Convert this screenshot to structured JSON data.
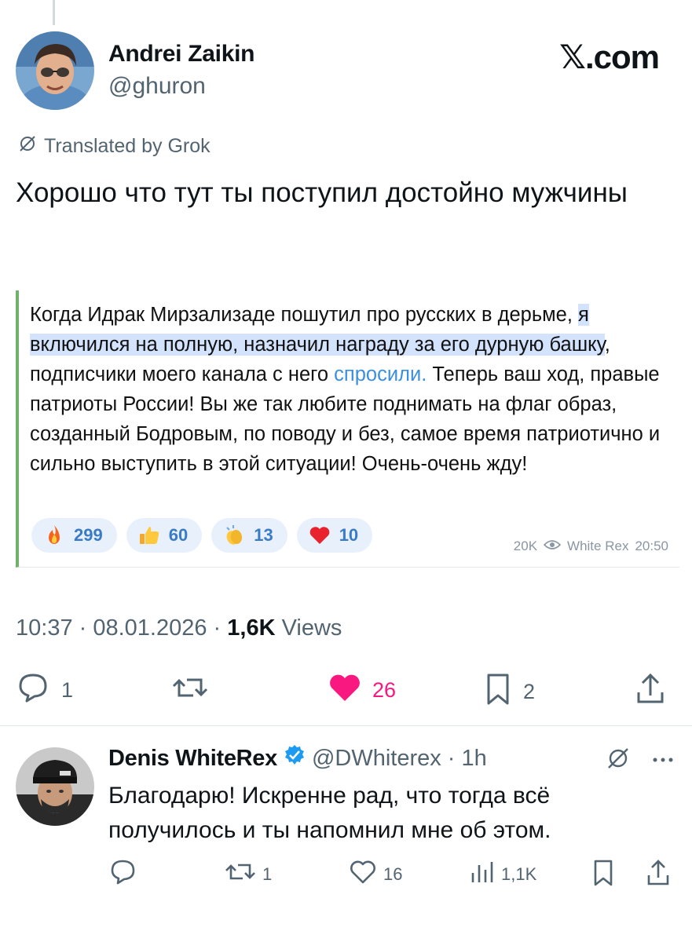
{
  "tweet": {
    "author_name": "Andrei Zaikin",
    "author_handle": "@ghuron",
    "brand": "𝕏.com",
    "translated_label": "Translated by Grok",
    "text": "Хорошо что тут ты поступил достойно мужчины",
    "timestamp": "10:37 · 08.01.2026 · ",
    "views_count": "1,6K",
    "views_label": " Views",
    "replies": "1",
    "likes": "26",
    "bookmarks": "2",
    "like_color": "#f91880"
  },
  "telegram_post": {
    "text_before": "Когда Идрак Мирзализаде пошутил про русских в дерьме, ",
    "text_highlighted": "я включился на полную, назначил награду за его дурную башку",
    "text_middle": ", подписчики моего канала с него ",
    "link_text": "спросили.",
    "text_after": " Теперь ваш ход, правые патриоты России! Вы же так любите поднимать на флаг образ, созданный Бодровым, по поводу и без, самое время патриотично и сильно выступить в этой ситуации! Очень-очень жду!",
    "reactions": [
      {
        "icon": "fire-emoji",
        "count": "299"
      },
      {
        "icon": "thumbs-up-emoji",
        "count": "60"
      },
      {
        "icon": "clapping-hands-emoji",
        "count": "13"
      },
      {
        "icon": "red-heart-emoji",
        "count": "10"
      }
    ],
    "views": "20K",
    "channel": "White Rex",
    "time": "20:50",
    "accent_color": "#6fb26a",
    "link_color": "#3a8fe0"
  },
  "reply": {
    "author_name": "Denis WhiteRex",
    "author_handle": "@DWhiterex",
    "time": "· 1h",
    "text": "Благодарю! Искренне рад, что тогда всё получилось и ты напомнил мне об этом.",
    "retweets": "1",
    "likes": "16",
    "views": "1,1K",
    "verified_color": "#1d9bf0"
  }
}
